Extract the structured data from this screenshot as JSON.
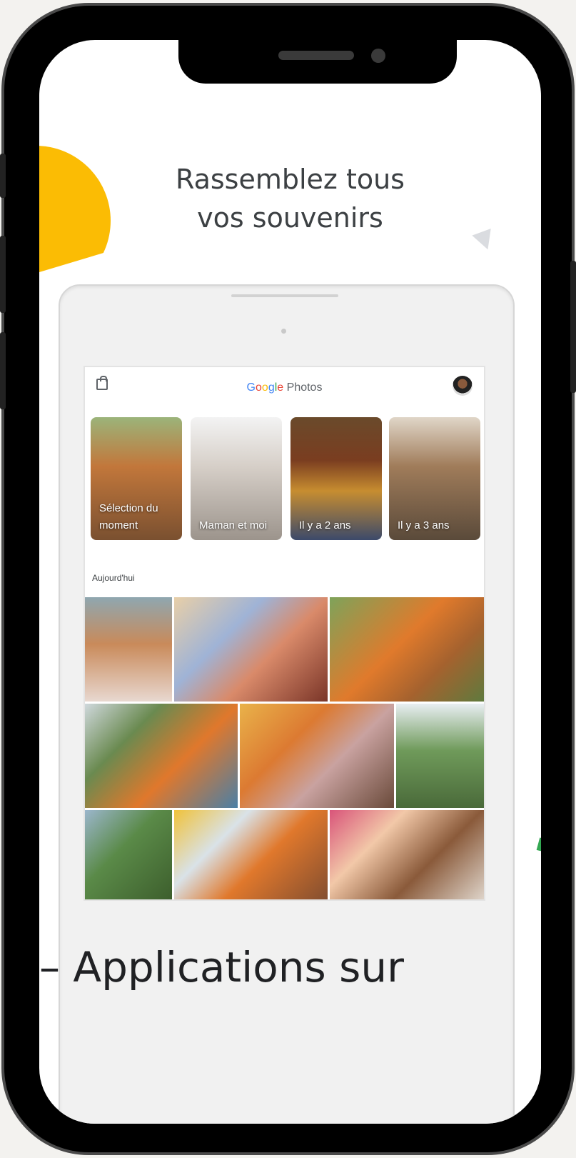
{
  "headline": {
    "line1": "Rassemblez tous",
    "line2": "vos souvenirs"
  },
  "app": {
    "logo_google": [
      "G",
      "o",
      "o",
      "g",
      "l",
      "e"
    ],
    "logo_suffix": "Photos"
  },
  "memories": [
    {
      "label": "Sélection du moment"
    },
    {
      "label": "Maman et moi"
    },
    {
      "label": "Il y a 2 ans"
    },
    {
      "label": "Il y a 3 ans"
    }
  ],
  "section_today": "Aujourd'hui",
  "bottom_text": "– Applications sur",
  "colors": {
    "yellow": "#fbbc04",
    "green": "#34a853",
    "blue": "#4285f4",
    "red": "#ea4335"
  }
}
